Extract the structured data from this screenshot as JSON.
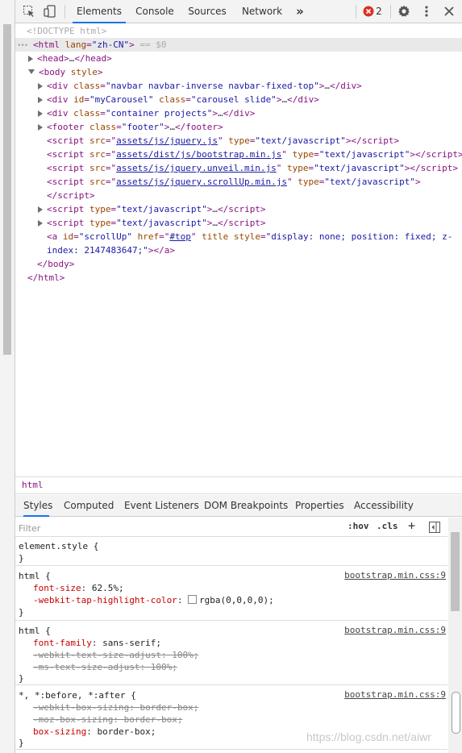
{
  "toolbar": {
    "tabs": [
      "Elements",
      "Console",
      "Sources",
      "Network"
    ],
    "more": "»",
    "error_count": "2"
  },
  "dom": {
    "doctype": "<!DOCTYPE html>",
    "html_open_tag": "html",
    "html_lang_attr": "lang",
    "html_lang_val": "\"zh-CN\"",
    "dollar": "== $0",
    "head": "head",
    "body": "body",
    "body_attr": "style",
    "div1_class": "\"navbar navbar-inverse navbar-fixed-top\"",
    "div2_id": "\"myCarousel\"",
    "div2_class": "\"carousel slide\"",
    "div3_class": "\"container projects\"",
    "footer_class": "\"footer\"",
    "scripts": [
      {
        "src": "assets/js/jquery.js",
        "type": "\"text/javascript\""
      },
      {
        "src": "assets/dist/js/bootstrap.min.js",
        "type": "\"text/javascript\""
      },
      {
        "src": "assets/js/jquery.unveil.min.js",
        "type": "\"text/javascript\""
      },
      {
        "src": "assets/js/jquery.scrollUp.min.js",
        "type": "\"text/javascript\""
      }
    ],
    "inline_script_type": "\"text/javascript\"",
    "a_id": "\"scrollUp\"",
    "a_href": "#top",
    "a_style_1": "\"display: none; position: fixed; z-",
    "a_style_2": "index: 2147483647;\""
  },
  "breadcrumb": "html",
  "subtabs": [
    "Styles",
    "Computed",
    "Event Listeners",
    "DOM Breakpoints",
    "Properties",
    "Accessibility"
  ],
  "filter": {
    "placeholder": "Filter",
    "hov": ":hov",
    "cls": ".cls",
    "plus": "+"
  },
  "styles": {
    "element_style": "element.style {",
    "close": "}",
    "rules": [
      {
        "selector": "html {",
        "source": "bootstrap.min.css:9",
        "props": [
          {
            "name": "font-size",
            "value": "62.5%;"
          },
          {
            "name": "-webkit-tap-highlight-color",
            "value": "rgba(0,0,0,0);"
          }
        ]
      },
      {
        "selector": "html {",
        "source": "bootstrap.min.css:9",
        "props": [
          {
            "name": "font-family",
            "value": "sans-serif;"
          },
          {
            "name": "-webkit-text-size-adjust",
            "value": "100%;"
          },
          {
            "name": "-ms-text-size-adjust",
            "value": "100%;"
          }
        ]
      },
      {
        "selector": "*, *:before, *:after {",
        "source": "bootstrap.min.css:9",
        "props": [
          {
            "name": "-webkit-box-sizing",
            "value": "border-box;"
          },
          {
            "name": "-moz-box-sizing",
            "value": "border-box;"
          },
          {
            "name": "box-sizing",
            "value": "border-box;"
          }
        ]
      }
    ]
  },
  "watermark": "https://blog.csdn.net/aiwr"
}
